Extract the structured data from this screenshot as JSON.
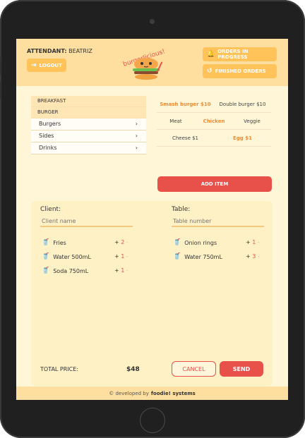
{
  "header": {
    "attendant_label": "ATTENDANT:",
    "attendant_name": "BEATRIZ",
    "logout_label": "LOGOUT",
    "orders_in_progress_label": "ORDERS IN PROGRESS",
    "finished_orders_label": "FINISHED ORDERS",
    "logo_text": "burgerlicious!"
  },
  "categories": {
    "breakfast": "BREAKFAST",
    "burger": "BURGER",
    "items": [
      {
        "label": "Burgers"
      },
      {
        "label": "Sides"
      },
      {
        "label": "Drinks"
      }
    ]
  },
  "options": {
    "burgers": [
      {
        "label": "Smash burger $10",
        "selected": true
      },
      {
        "label": "Double burger $10",
        "selected": false
      }
    ],
    "proteins": [
      {
        "label": "Meat",
        "selected": false
      },
      {
        "label": "Chicken",
        "selected": true
      },
      {
        "label": "Veggie",
        "selected": false
      }
    ],
    "extras": [
      {
        "label": "Cheese $1",
        "selected": false
      },
      {
        "label": "Egg $1",
        "selected": true
      }
    ]
  },
  "add_item_label": "ADD ITEM",
  "order": {
    "client_label": "Client:",
    "client_placeholder": "Client name",
    "table_label": "Table:",
    "table_placeholder": "Table number",
    "left_items": [
      {
        "name": "Fries",
        "qty": "2"
      },
      {
        "name": "Water 500mL",
        "qty": "1"
      },
      {
        "name": "Soda 750mL",
        "qty": "1"
      }
    ],
    "right_items": [
      {
        "name": "Onion rings",
        "qty": "1"
      },
      {
        "name": "Water 750mL",
        "qty": "3"
      }
    ],
    "plus": "+",
    "minus": "-",
    "total_label": "TOTAL PRICE:",
    "total_value": "$48",
    "cancel_label": "CANCEL",
    "send_label": "SEND"
  },
  "footer": {
    "prefix": "© developed by",
    "brand": "foodie! systems"
  },
  "colors": {
    "accent_red": "#e8504a",
    "header_yellow": "#ffdf9f",
    "button_yellow": "#ffc35a",
    "selected_orange": "#f08b2f"
  },
  "icons": {
    "logout": "logout-icon",
    "bell": "bell-icon",
    "history": "history-icon",
    "chevron": "chevron-right-icon",
    "item": "cup-icon"
  }
}
